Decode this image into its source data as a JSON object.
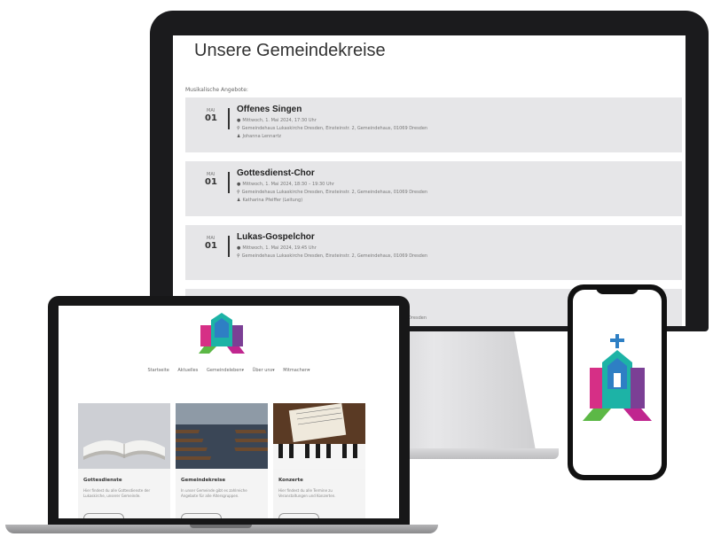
{
  "desktop": {
    "page_title": "Unsere Gemeindekreise",
    "section_label": "Musikalische Angebote:",
    "events": [
      {
        "month": "MAI",
        "day": "01",
        "title": "Offenes Singen",
        "date_time": "Mittwoch, 1. Mai 2024, 17:30 Uhr",
        "location": "Gemeindehaus Lukaskirche Dresden, Einsteinstr. 2, Gemeindehaus, 01069 Dresden",
        "person": "Johanna Lennartz"
      },
      {
        "month": "MAI",
        "day": "01",
        "title": "Gottesdienst-Chor",
        "date_time": "Mittwoch, 1. Mai 2024, 18:30 – 19:30 Uhr",
        "location": "Gemeindehaus Lukaskirche Dresden, Einsteinstr. 2, Gemeindehaus, 01069 Dresden",
        "person": "Katharina Pfeiffer (Leitung)"
      },
      {
        "month": "MAI",
        "day": "01",
        "title": "Lukas-Gospelchor",
        "date_time": "Mittwoch, 1. Mai 2024, 19:45 Uhr",
        "location": "Gemeindehaus Lukaskirche Dresden, Einsteinstr. 2, Gemeindehaus, 01069 Dresden",
        "person": ""
      },
      {
        "month": "",
        "day": "",
        "title": "",
        "date_time": "",
        "location": "069 Dresden",
        "person": ""
      }
    ]
  },
  "laptop": {
    "nav": [
      "Startseite",
      "Aktuelles",
      "Gemeindeleben▾",
      "Über uns▾",
      "Mitmachen▾"
    ],
    "cards": [
      {
        "title": "Gottesdienste",
        "text": "Hier findest du alle Gottesdienste der Lukaskirche, unserer Gemeinde."
      },
      {
        "title": "Gemeindekreise",
        "text": "In unser Gemeinde gibt es zahlreiche Angebote für alle Altersgruppen."
      },
      {
        "title": "Konzerte",
        "text": "Hier findest du alle Termine zu Veranstaltungen und Konzerten."
      }
    ]
  },
  "colors": {
    "pink": "#d62f86",
    "teal": "#1db3a6",
    "green": "#5cb846",
    "blue": "#2e7fc4",
    "purple": "#7b3f95",
    "magenta": "#c0268f"
  }
}
